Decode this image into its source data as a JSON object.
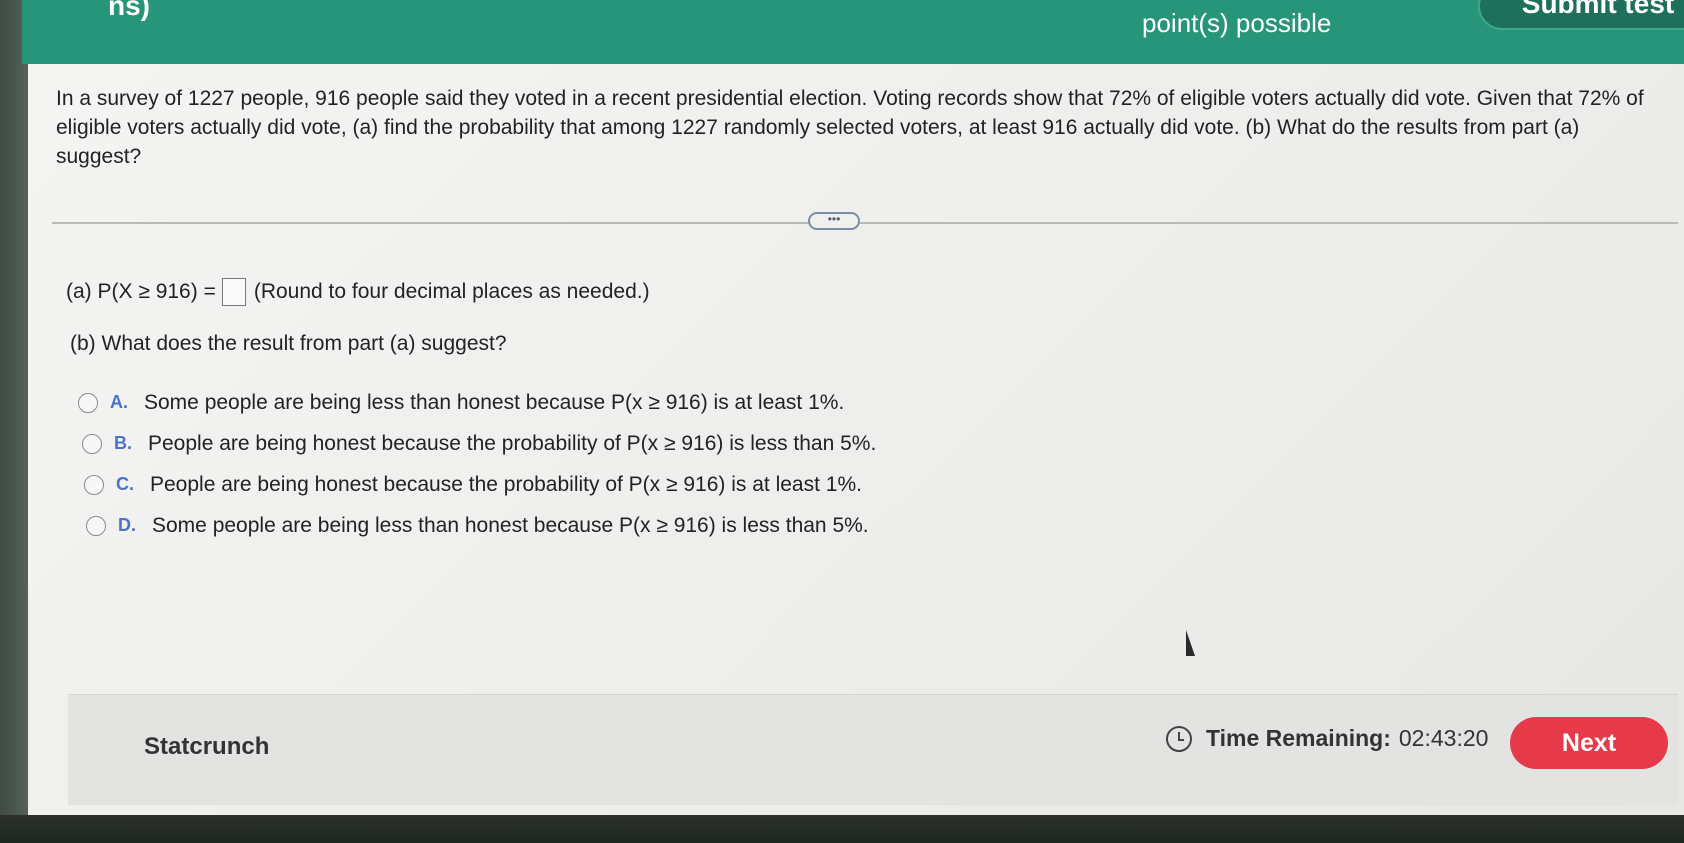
{
  "header": {
    "left_text": "ns)",
    "points_text": "point(s) possible",
    "submit_label": "Submit test"
  },
  "question": {
    "text": "In a survey of 1227 people, 916 people said they voted in a recent presidential election. Voting records show that 72% of eligible voters actually did vote. Given that 72% of eligible voters actually did vote, (a) find the probability that among 1227 randomly selected voters, at least 916 actually did vote. (b) What do the results from part (a) suggest?"
  },
  "expand_label": "•••",
  "part_a": {
    "prefix": "(a) P(X ≥ 916) =",
    "answer_value": "",
    "hint": "(Round to four decimal places as needed.)"
  },
  "part_b": {
    "prompt": "(b) What does the result from part (a) suggest?"
  },
  "options": [
    {
      "letter": "A.",
      "text": "Some people are being less than honest because P(x ≥ 916) is at least 1%."
    },
    {
      "letter": "B.",
      "text": "People are being honest because the probability of P(x ≥ 916) is less than 5%."
    },
    {
      "letter": "C.",
      "text": "People are being honest because the probability of P(x ≥ 916) is at least 1%."
    },
    {
      "letter": "D.",
      "text": "Some people are being less than honest because P(x ≥ 916) is less than 5%."
    }
  ],
  "footer": {
    "statcrunch_label": "Statcrunch",
    "time_label": "Time Remaining:",
    "time_value": "02:43:20",
    "next_label": "Next"
  },
  "colors": {
    "header_teal": "#27957a",
    "next_red": "#e63a4a",
    "option_letter_blue": "#4a74c9"
  },
  "icons": [
    "clock-icon",
    "radio-icon",
    "cursor-icon"
  ]
}
